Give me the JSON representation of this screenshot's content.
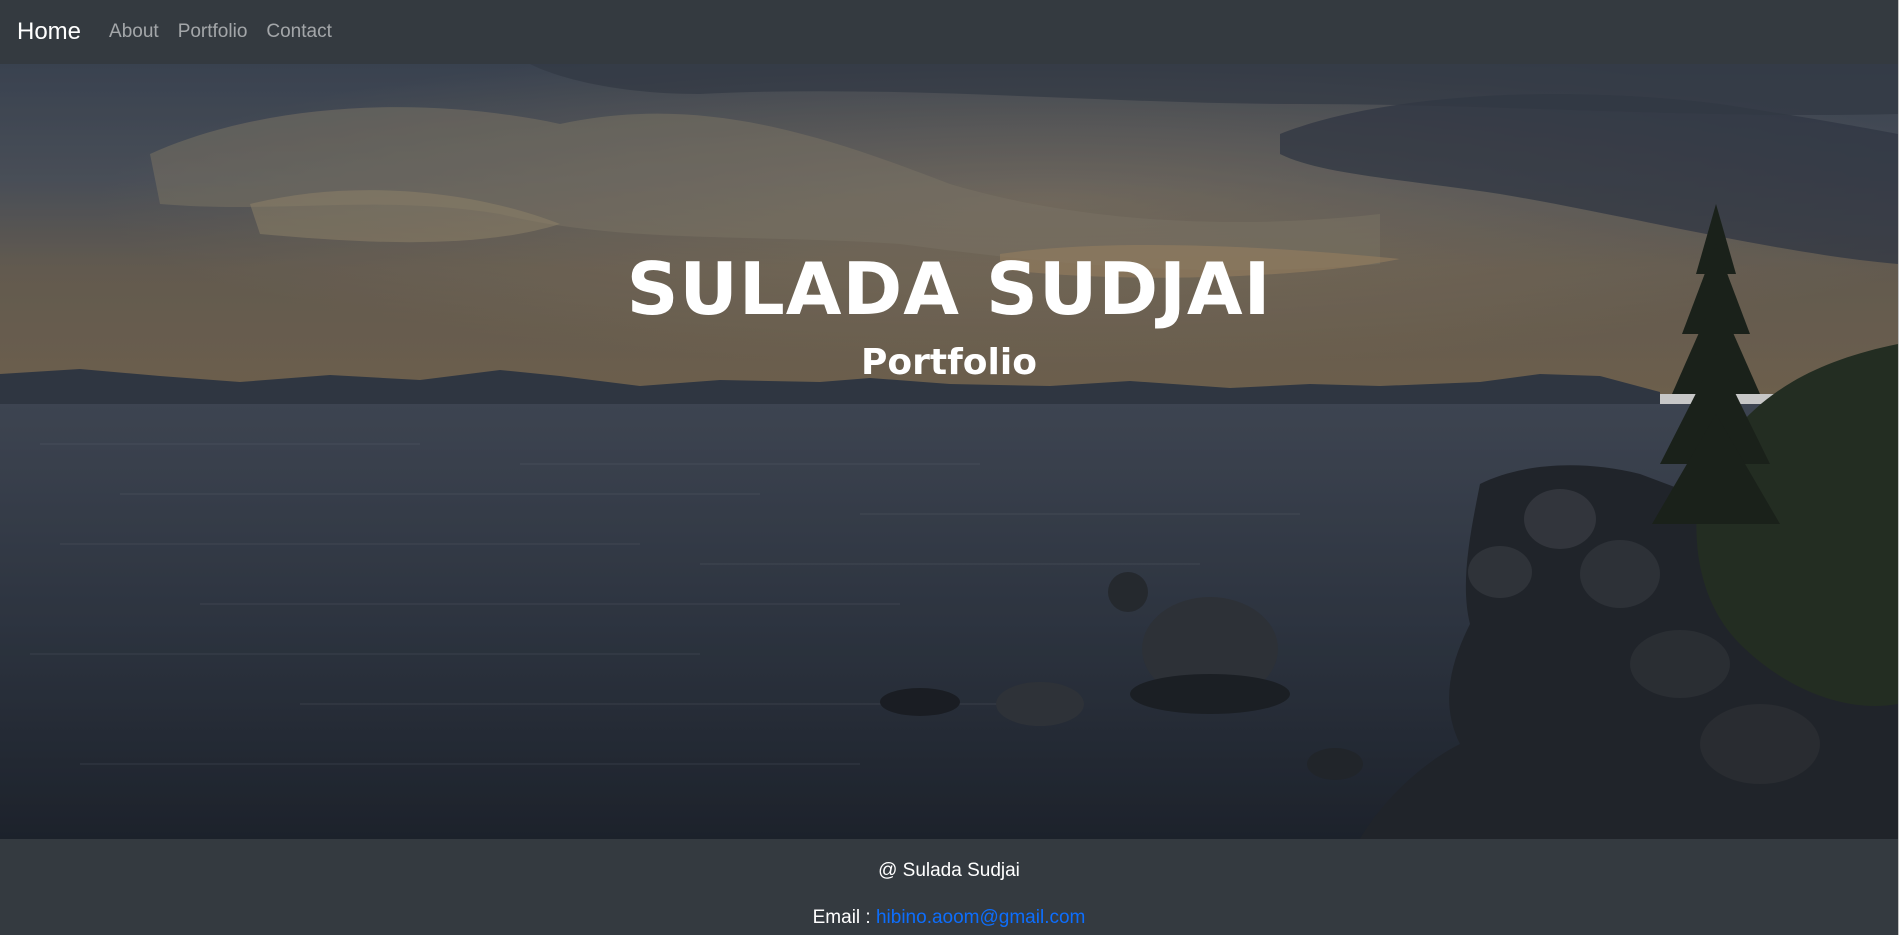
{
  "navbar": {
    "brand": "Home",
    "links": [
      "About",
      "Portfolio",
      "Contact"
    ]
  },
  "hero": {
    "title": "SULADA SUDJAI",
    "subtitle": "Portfolio"
  },
  "footer": {
    "copyright": "@ Sulada Sudjai",
    "email_label": "Email :",
    "email": "hibino.aoom@gmail.com"
  },
  "colors": {
    "navbar_bg": "#343a40",
    "nav_link": "rgba(255,255,255,0.55)",
    "email_link": "#0d6efd"
  }
}
